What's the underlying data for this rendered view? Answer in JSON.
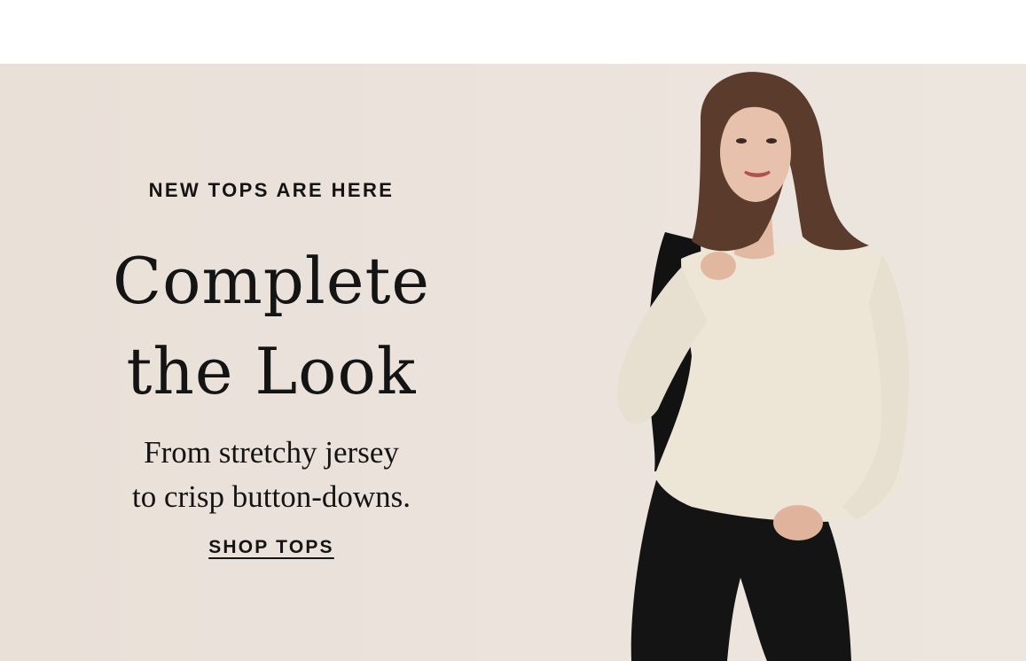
{
  "hero": {
    "eyebrow": "NEW TOPS ARE HERE",
    "headline_line1": "Complete",
    "headline_line2": "the Look",
    "subhead_line1": "From stretchy jersey",
    "subhead_line2": "to crisp button-downs.",
    "cta_label": "SHOP TOPS"
  },
  "colors": {
    "background": "#e9e0d8",
    "text": "#141414",
    "top_bar": "#ffffff"
  }
}
